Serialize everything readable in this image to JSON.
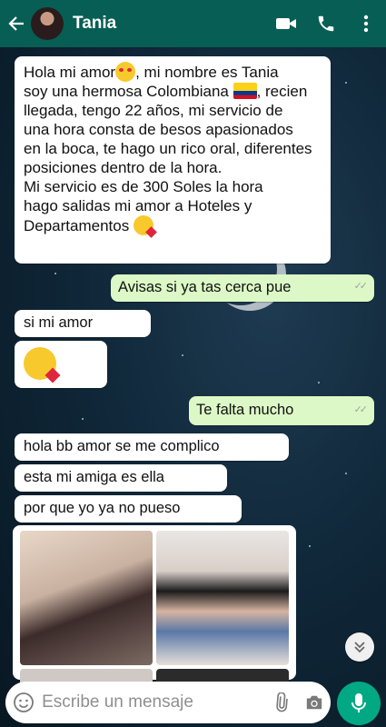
{
  "header": {
    "contact_name": "Tania"
  },
  "messages": [
    {
      "direction": "in",
      "lines": [
        "Hola mi amor",
        ", mi nombre es  Tania",
        "soy una hermosa Colombiana ",
        ", recien",
        "llegada, tengo 22 años, mi servicio de",
        "una hora consta de besos apasionados",
        "en la boca, te hago un rico oral, diferentes",
        "posiciones dentro de la hora.",
        "Mi servicio es de 300 Soles la hora",
        "hago salidas mi amor a Hoteles y",
        "Departamentos "
      ]
    },
    {
      "direction": "out",
      "text": "Avisas si ya tas cerca pue"
    },
    {
      "direction": "in",
      "text": "si mi amor"
    },
    {
      "direction": "in",
      "text": ""
    },
    {
      "direction": "out",
      "text": "Te falta mucho"
    },
    {
      "direction": "in",
      "text": "hola bb amor se me complico"
    },
    {
      "direction": "in",
      "text": "esta mi amiga es ella"
    },
    {
      "direction": "in",
      "text": "por que yo ya no pueso"
    }
  ],
  "composer": {
    "placeholder": "Escribe un mensaje"
  },
  "icons": {
    "back": "arrow-left-icon",
    "video": "video-call-icon",
    "call": "phone-icon",
    "menu": "more-vert-icon",
    "emoji": "emoji-icon",
    "attach": "paperclip-icon",
    "camera": "camera-icon",
    "mic": "microphone-icon",
    "scroll": "double-chevron-down-icon"
  },
  "colors": {
    "header": "#075e54",
    "outgoing_bubble": "#dcf8c6",
    "incoming_bubble": "#ffffff",
    "mic_button": "#00a884"
  }
}
